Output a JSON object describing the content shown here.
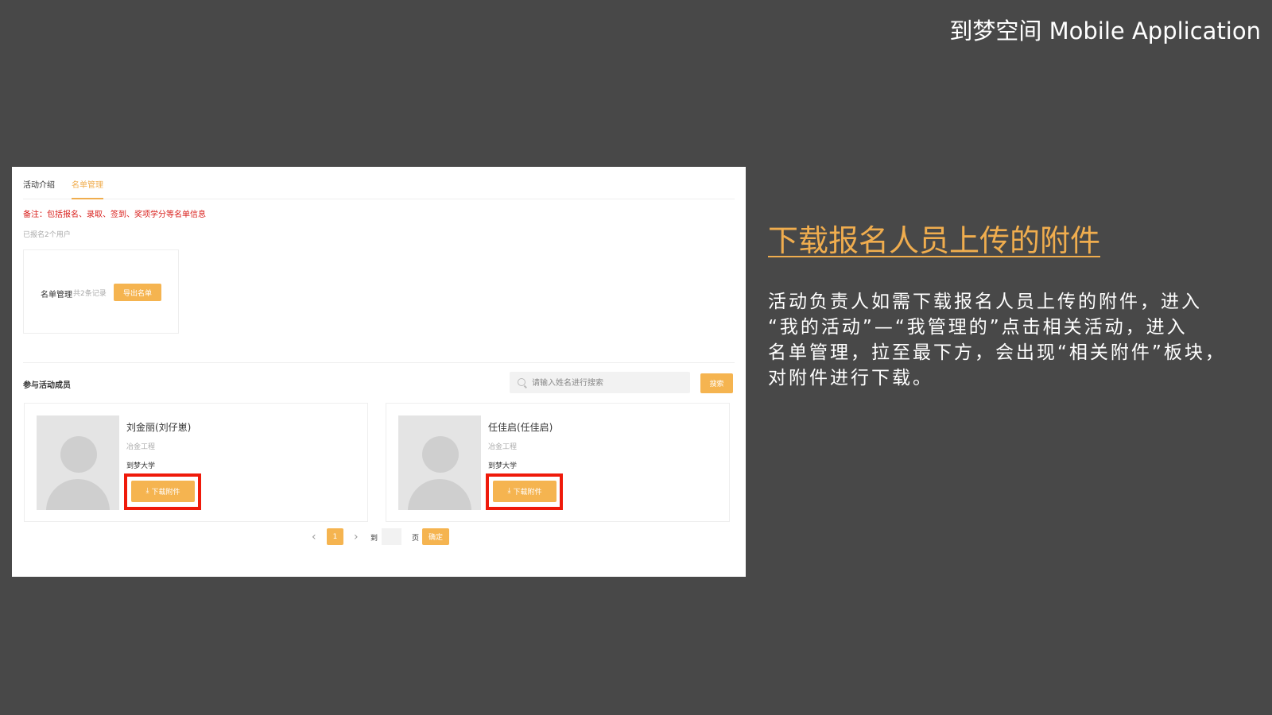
{
  "slide": {
    "title": "到梦空间 Mobile Application",
    "heading": "下载报名人员上传的附件",
    "description_lines": [
      "活动负责人如需下载报名人员上传的附件，进入",
      "“我的活动”—“我管理的”点击相关活动，进入",
      "名单管理，拉至最下方，会出现“相关附件”板块，",
      "对附件进行下载。"
    ]
  },
  "screenshot": {
    "tabs": [
      {
        "label": "活动介绍",
        "active": false
      },
      {
        "label": "名单管理",
        "active": true
      }
    ],
    "note": "备注：包括报名、录取、签到、奖项学分等名单信息",
    "registered_count": "已报名2个用户",
    "management": {
      "label": "名单管理",
      "record_count": "共2条记录",
      "export_button": "导出名单"
    },
    "members_section": {
      "label": "参与活动成员",
      "search_placeholder": "请输入姓名进行搜索",
      "search_button": "搜索",
      "members": [
        {
          "name": "刘金丽(刘仔崽)",
          "major": "冶金工程",
          "school": "到梦大学",
          "download_button": "下载附件"
        },
        {
          "name": "任佳启(任佳启)",
          "major": "冶金工程",
          "school": "到梦大学",
          "download_button": "下载附件"
        }
      ]
    },
    "pagination": {
      "current_page": "1",
      "goto_label": "到",
      "page_label": "页",
      "confirm_button": "确定"
    }
  },
  "colors": {
    "background": "#484848",
    "accent": "#f0ad4e",
    "note_red": "#d9211d",
    "highlight_red": "#ef1a0a"
  },
  "icons": [
    "search-icon",
    "download-icon",
    "chevron-left-icon",
    "chevron-right-icon",
    "avatar-placeholder-icon"
  ]
}
